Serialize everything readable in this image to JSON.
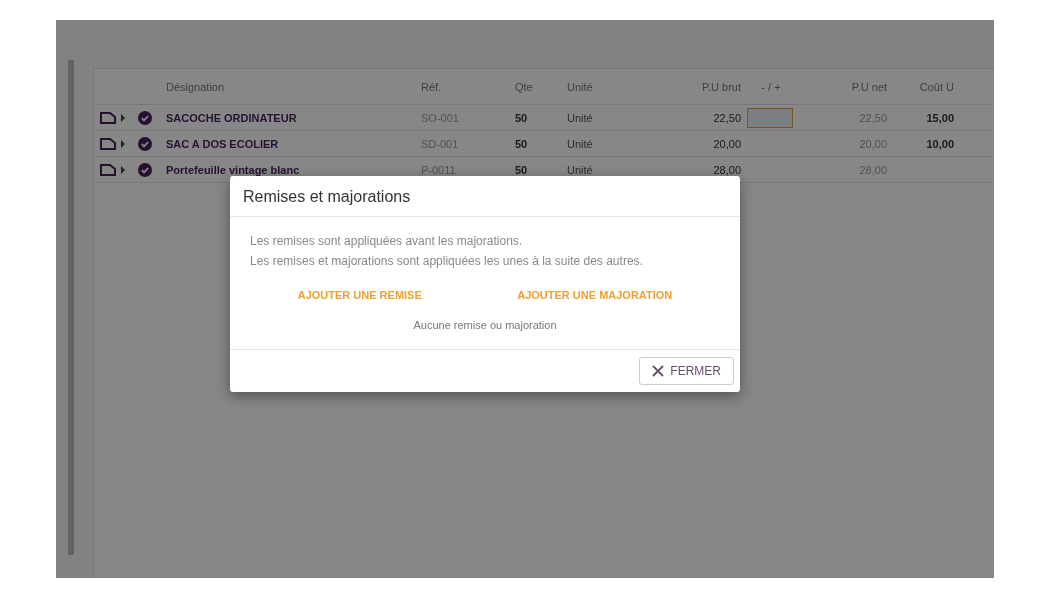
{
  "table": {
    "columns": [
      "Désignation",
      "Réf.",
      "Qte",
      "Unité",
      "P.U brut",
      "- / +",
      "P.U net",
      "Coût U"
    ],
    "rows": [
      {
        "name": "SACOCHE ORDINATEUR",
        "ref": "SO-001",
        "qty": "50",
        "unit": "Unité",
        "pu_brut": "22,50",
        "adjust_field": true,
        "pu_net": "22,50",
        "cout_u": "15,00",
        "validated": true
      },
      {
        "name": "SAC A DOS ECOLIER",
        "ref": "SD-001",
        "qty": "50",
        "unit": "Unité",
        "pu_brut": "20,00",
        "adjust_field": false,
        "pu_net": "20,00",
        "cout_u": "10,00",
        "validated": true
      },
      {
        "name": "Portefeuille vintage blanc",
        "ref": "P-0011",
        "qty": "50",
        "unit": "Unité",
        "pu_brut": "28,00",
        "adjust_field": false,
        "pu_net": "28,00",
        "validated": true
      }
    ]
  },
  "dialog": {
    "title": "Remises et majorations",
    "lines": [
      "Les remises sont appliquées avant les majorations.",
      "Les remises et majorations sont appliquées les unes à la suite des autres."
    ],
    "actions": [
      "AJOUTER UNE REMISE",
      "AJOUTER UNE MAJORATION"
    ],
    "empty_note": "Aucune remise ou majoration",
    "close_button": "FERMER"
  }
}
